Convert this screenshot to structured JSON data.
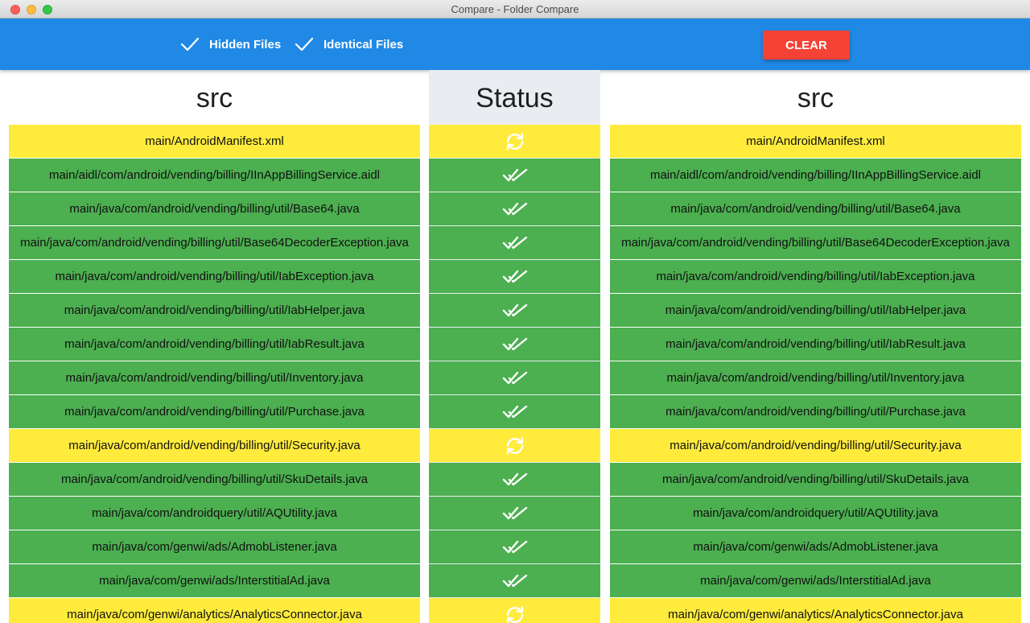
{
  "window": {
    "title": "Compare - Folder Compare"
  },
  "toolbar": {
    "hidden_files_label": "Hidden Files",
    "identical_files_label": "Identical Files",
    "clear_label": "CLEAR"
  },
  "columns": {
    "left_title": "src",
    "status_title": "Status",
    "right_title": "src"
  },
  "colors": {
    "toolbar": "#2089e5",
    "changed": "#ffeb3b",
    "identical": "#4caf50",
    "clear_button": "#f44336"
  },
  "rows": [
    {
      "left": "main/AndroidManifest.xml",
      "right": "main/AndroidManifest.xml",
      "status": "changed"
    },
    {
      "left": "main/aidl/com/android/vending/billing/IInAppBillingService.aidl",
      "right": "main/aidl/com/android/vending/billing/IInAppBillingService.aidl",
      "status": "identical"
    },
    {
      "left": "main/java/com/android/vending/billing/util/Base64.java",
      "right": "main/java/com/android/vending/billing/util/Base64.java",
      "status": "identical"
    },
    {
      "left": "main/java/com/android/vending/billing/util/Base64DecoderException.java",
      "right": "main/java/com/android/vending/billing/util/Base64DecoderException.java",
      "status": "identical"
    },
    {
      "left": "main/java/com/android/vending/billing/util/IabException.java",
      "right": "main/java/com/android/vending/billing/util/IabException.java",
      "status": "identical"
    },
    {
      "left": "main/java/com/android/vending/billing/util/IabHelper.java",
      "right": "main/java/com/android/vending/billing/util/IabHelper.java",
      "status": "identical"
    },
    {
      "left": "main/java/com/android/vending/billing/util/IabResult.java",
      "right": "main/java/com/android/vending/billing/util/IabResult.java",
      "status": "identical"
    },
    {
      "left": "main/java/com/android/vending/billing/util/Inventory.java",
      "right": "main/java/com/android/vending/billing/util/Inventory.java",
      "status": "identical"
    },
    {
      "left": "main/java/com/android/vending/billing/util/Purchase.java",
      "right": "main/java/com/android/vending/billing/util/Purchase.java",
      "status": "identical"
    },
    {
      "left": "main/java/com/android/vending/billing/util/Security.java",
      "right": "main/java/com/android/vending/billing/util/Security.java",
      "status": "changed"
    },
    {
      "left": "main/java/com/android/vending/billing/util/SkuDetails.java",
      "right": "main/java/com/android/vending/billing/util/SkuDetails.java",
      "status": "identical"
    },
    {
      "left": "main/java/com/androidquery/util/AQUtility.java",
      "right": "main/java/com/androidquery/util/AQUtility.java",
      "status": "identical"
    },
    {
      "left": "main/java/com/genwi/ads/AdmobListener.java",
      "right": "main/java/com/genwi/ads/AdmobListener.java",
      "status": "identical"
    },
    {
      "left": "main/java/com/genwi/ads/InterstitialAd.java",
      "right": "main/java/com/genwi/ads/InterstitialAd.java",
      "status": "identical"
    },
    {
      "left": "main/java/com/genwi/analytics/AnalyticsConnector.java",
      "right": "main/java/com/genwi/analytics/AnalyticsConnector.java",
      "status": "changed"
    }
  ]
}
